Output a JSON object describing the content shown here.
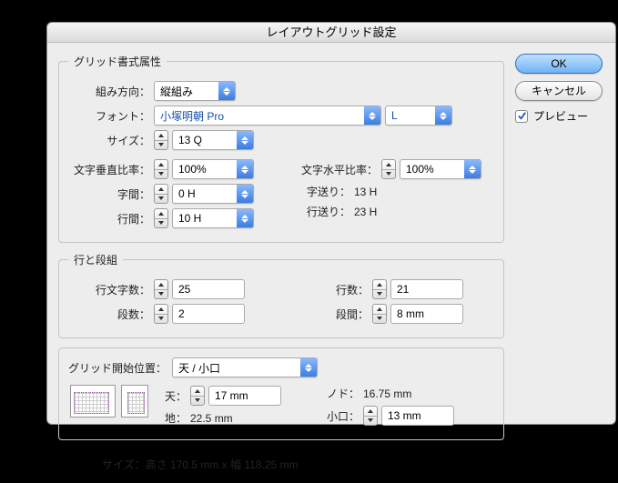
{
  "title": "レイアウトグリッド設定",
  "buttons": {
    "ok": "OK",
    "cancel": "キャンセル"
  },
  "preview_checkbox": "プレビュー",
  "grid_attr": {
    "legend": "グリッド書式属性",
    "direction_label": "組み方向：",
    "direction": "縦組み",
    "font_label": "フォント：",
    "font": "小塚明朝 Pro",
    "font_weight": "L",
    "size_label": "サイズ：",
    "size": "13 Q",
    "vscale_label": "文字垂直比率：",
    "vscale": "100%",
    "hscale_label": "文字水平比率：",
    "hscale": "100%",
    "jikan_label": "字間：",
    "jikan": "0 H",
    "jiokuri_label": "字送り：",
    "jiokuri": "13 H",
    "gyokan_label": "行間：",
    "gyokan": "10 H",
    "gyookuri_label": "行送り：",
    "gyookuri": "23 H"
  },
  "lines": {
    "legend": "行と段組",
    "chars_label": "行文字数：",
    "chars": "25",
    "lines_label": "行数：",
    "lines": "21",
    "cols_label": "段数：",
    "cols": "2",
    "gap_label": "段間：",
    "gap": "8 mm"
  },
  "start": {
    "legend_label": "グリッド開始位置：",
    "legend_val": "天 / 小口",
    "ten_label": "天：",
    "ten": "17 mm",
    "nodo_label": "ノド：",
    "nodo": "16.75 mm",
    "chi_label": "地：",
    "chi": "22.5 mm",
    "koguchi_label": "小口：",
    "koguchi": "13 mm"
  },
  "size_summary": "サイズ：高さ 170.5 mm x 幅 118.25 mm"
}
